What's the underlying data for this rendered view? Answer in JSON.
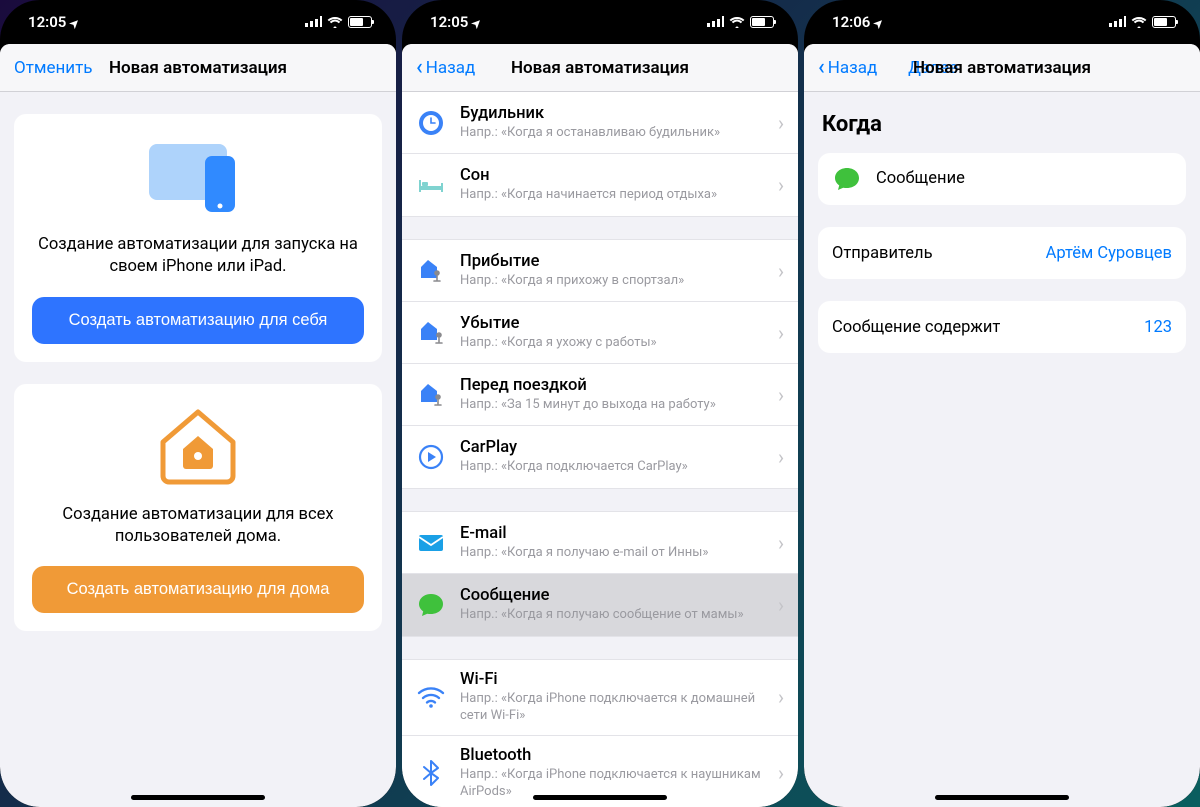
{
  "statusbar": {
    "time1": "12:05",
    "time2": "12:05",
    "time3": "12:06"
  },
  "nav": {
    "cancel": "Отменить",
    "back": "Назад",
    "next": "Далее",
    "title": "Новая автоматизация"
  },
  "screen1": {
    "personal": {
      "text": "Создание автоматизации для запуска на своем iPhone или iPad.",
      "cta": "Создать автоматизацию для себя"
    },
    "home": {
      "text": "Создание автоматизации для всех пользователей дома.",
      "cta": "Создать автоматизацию для дома"
    }
  },
  "triggers": {
    "alarm": {
      "title": "Будильник",
      "sub": "Напр.: «Когда я останавливаю будильник»"
    },
    "sleep": {
      "title": "Сон",
      "sub": "Напр.: «Когда начинается период отдыха»"
    },
    "arrive": {
      "title": "Прибытие",
      "sub": "Напр.: «Когда я прихожу в спортзал»"
    },
    "leave": {
      "title": "Убытие",
      "sub": "Напр.: «Когда я ухожу с работы»"
    },
    "commute": {
      "title": "Перед поездкой",
      "sub": "Напр.: «За 15 минут до выхода на работу»"
    },
    "carplay": {
      "title": "CarPlay",
      "sub": "Напр.: «Когда подключается CarPlay»"
    },
    "email": {
      "title": "E-mail",
      "sub": "Напр.: «Когда я получаю e-mail от Инны»"
    },
    "message": {
      "title": "Сообщение",
      "sub": "Напр.: «Когда я получаю сообщение от мамы»"
    },
    "wifi": {
      "title": "Wi-Fi",
      "sub": "Напр.: «Когда iPhone подключается к домашней сети Wi-Fi»"
    },
    "bluetooth": {
      "title": "Bluetooth",
      "sub": "Напр.: «Когда iPhone подключается к наушникам AirPods»"
    }
  },
  "screen3": {
    "when": "Когда",
    "trigger_label": "Сообщение",
    "sender_label": "Отправитель",
    "sender_value": "Артём Суровцев",
    "contains_label": "Сообщение содержит",
    "contains_value": "123"
  }
}
